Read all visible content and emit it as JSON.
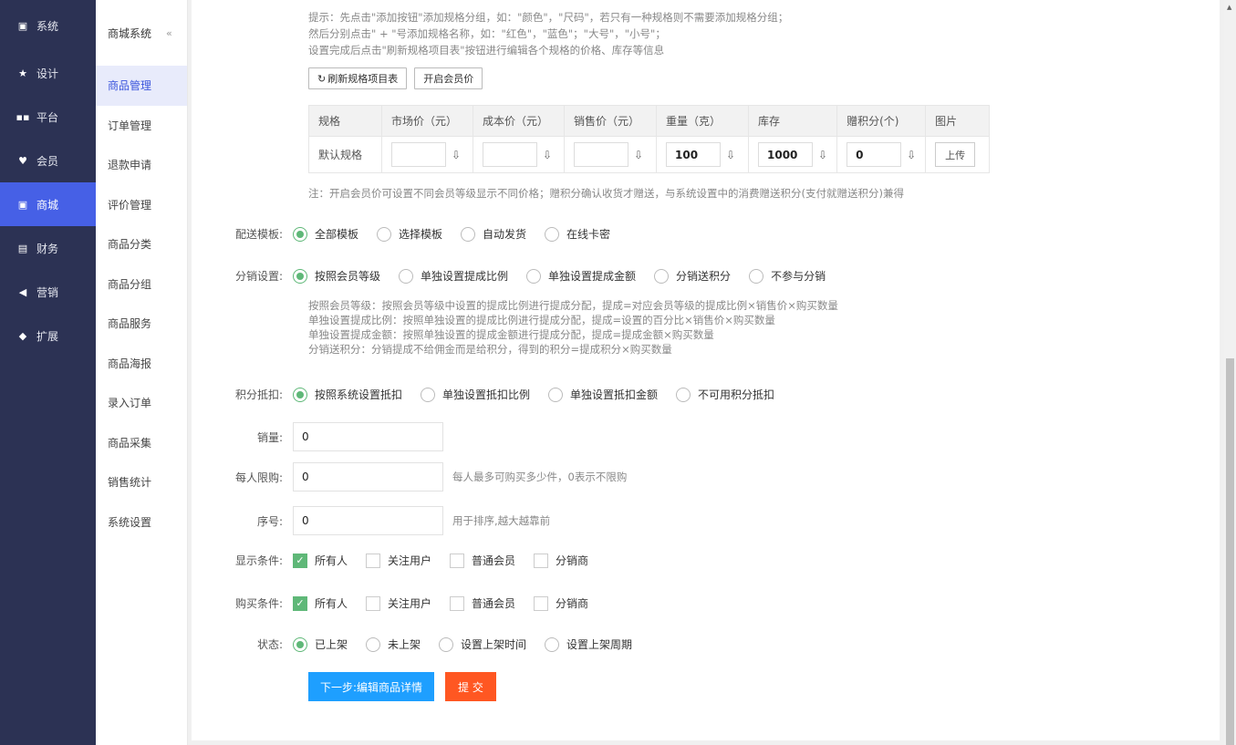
{
  "nav": {
    "items": [
      {
        "label": "系统",
        "icon": "monitor-icon",
        "glyph": "▣"
      },
      {
        "label": "设计",
        "icon": "star-icon",
        "glyph": "★"
      },
      {
        "label": "平台",
        "icon": "grid-icon",
        "glyph": "▪▪"
      },
      {
        "label": "会员",
        "icon": "heart-icon",
        "glyph": "♥"
      },
      {
        "label": "商城",
        "icon": "shop-icon",
        "glyph": "▣"
      },
      {
        "label": "财务",
        "icon": "wallet-icon",
        "glyph": "▤"
      },
      {
        "label": "营销",
        "icon": "megaphone-icon",
        "glyph": "◀"
      },
      {
        "label": "扩展",
        "icon": "cube-icon",
        "glyph": "◆"
      }
    ],
    "active_index": 4
  },
  "sub": {
    "title": "商城系统",
    "collapse": "«",
    "items": [
      "商品管理",
      "订单管理",
      "退款申请",
      "评价管理",
      "商品分类",
      "商品分组",
      "商品服务",
      "商品海报",
      "录入订单",
      "商品采集",
      "销售统计",
      "系统设置"
    ],
    "active_index": 0
  },
  "tips": [
    "提示：先点击\"添加按钮\"添加规格分组，如：\"颜色\"，\"尺码\"，若只有一种规格则不需要添加规格分组；",
    "然后分别点击\" + \"号添加规格名称，如：\"红色\"，\"蓝色\"；\"大号\"，\"小号\"；",
    "设置完成后点击\"刷新规格项目表\"按钮进行编辑各个规格的价格、库存等信息"
  ],
  "buttons": {
    "refresh": "刷新规格项目表",
    "refresh_glyph": "↻",
    "member_price": "开启会员价",
    "next": "下一步:编辑商品详情",
    "submit": "提 交"
  },
  "spec_table": {
    "headers": [
      "规格",
      "市场价（元）",
      "成本价（元）",
      "销售价（元）",
      "重量（克）",
      "库存",
      "赠积分(个)",
      "图片"
    ],
    "row_label": "默认规格",
    "values": [
      "",
      "",
      "",
      "100",
      "1000",
      "0"
    ],
    "pin_glyph": "⇩",
    "upload": "上传"
  },
  "note": "注：开启会员价可设置不同会员等级显示不同价格；赠积分确认收货才赠送，与系统设置中的消费赠送积分(支付就赠送积分)兼得",
  "delivery": {
    "label": "配送模板:",
    "options": [
      "全部模板",
      "选择模板",
      "自动发货",
      "在线卡密"
    ],
    "selected": 0
  },
  "distribution": {
    "label": "分销设置:",
    "options": [
      "按照会员等级",
      "单独设置提成比例",
      "单独设置提成金额",
      "分销送积分",
      "不参与分销"
    ],
    "selected": 0,
    "help": [
      "按照会员等级：按照会员等级中设置的提成比例进行提成分配，提成=对应会员等级的提成比例×销售价×购买数量",
      "单独设置提成比例：按照单独设置的提成比例进行提成分配，提成=设置的百分比×销售价×购买数量",
      "单独设置提成金额：按照单独设置的提成金额进行提成分配，提成=提成金额×购买数量",
      "分销送积分：分销提成不给佣金而是给积分，得到的积分=提成积分×购买数量"
    ]
  },
  "points": {
    "label": "积分抵扣:",
    "options": [
      "按照系统设置抵扣",
      "单独设置抵扣比例",
      "单独设置抵扣金额",
      "不可用积分抵扣"
    ],
    "selected": 0
  },
  "sales": {
    "label": "销量:",
    "value": "0"
  },
  "limit": {
    "label": "每人限购:",
    "value": "0",
    "hint": "每人最多可购买多少件，0表示不限购"
  },
  "order": {
    "label": "序号:",
    "value": "0",
    "hint": "用于排序,越大越靠前"
  },
  "show_cond": {
    "label": "显示条件:",
    "options": [
      "所有人",
      "关注用户",
      "普通会员",
      "分销商"
    ],
    "checked": [
      true,
      false,
      false,
      false
    ]
  },
  "buy_cond": {
    "label": "购买条件:",
    "options": [
      "所有人",
      "关注用户",
      "普通会员",
      "分销商"
    ],
    "checked": [
      true,
      false,
      false,
      false
    ]
  },
  "status": {
    "label": "状态:",
    "options": [
      "已上架",
      "未上架",
      "设置上架时间",
      "设置上架周期"
    ],
    "selected": 0
  },
  "colors": {
    "nav_bg": "#2c3254",
    "nav_active": "#4660e6",
    "check_green": "#5fb878",
    "primary": "#1e9fff",
    "danger": "#ff5722"
  }
}
